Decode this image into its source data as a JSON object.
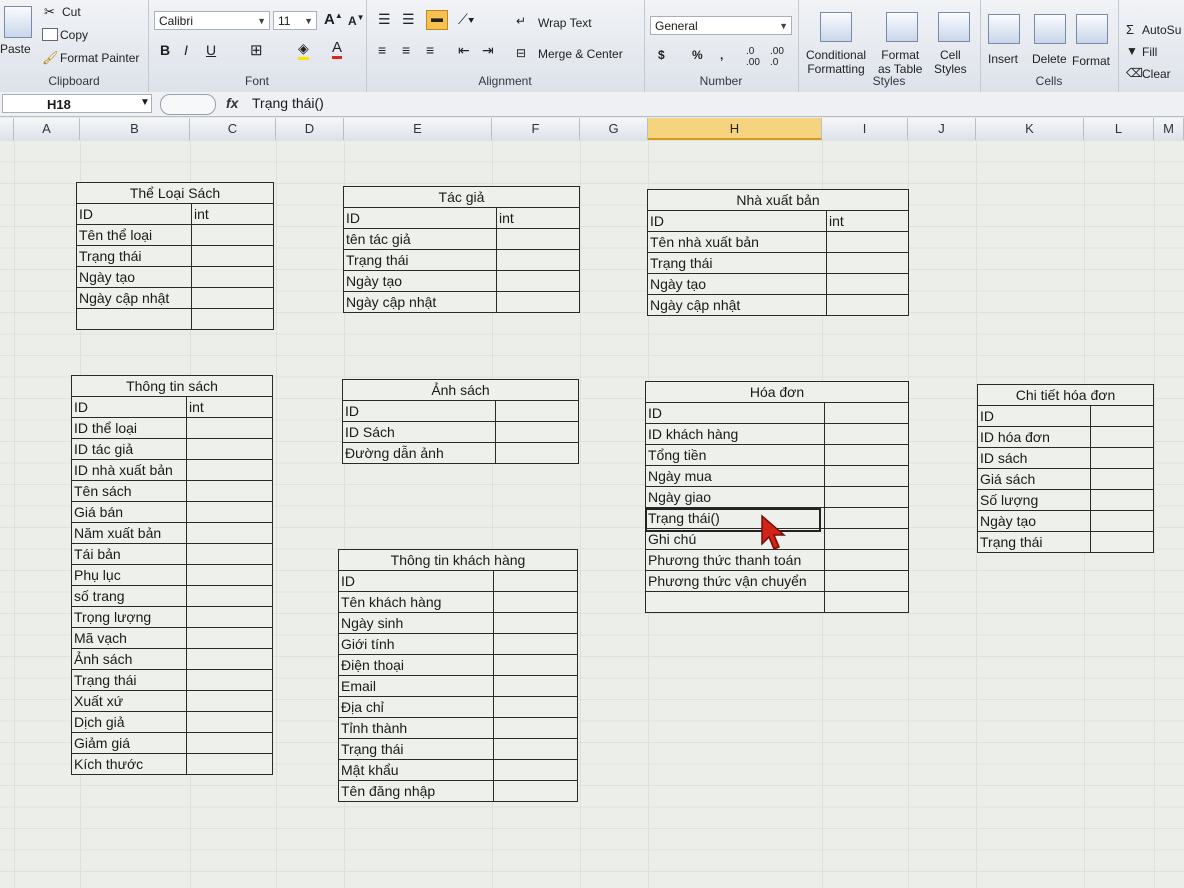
{
  "ribbon": {
    "clipboard": {
      "paste": "Paste",
      "cut": "Cut",
      "copy": "Copy",
      "format_painter": "Format Painter",
      "label": "Clipboard"
    },
    "font": {
      "name": "Calibri",
      "size": "11",
      "label": "Font"
    },
    "alignment": {
      "wrap": "Wrap Text",
      "merge": "Merge & Center",
      "label": "Alignment"
    },
    "number": {
      "format": "General",
      "currency": "$",
      "percent": "%",
      "comma": ",",
      "label": "Number"
    },
    "styles": {
      "conditional_1": "Conditional",
      "conditional_2": "Formatting",
      "format_table_1": "Format",
      "format_table_2": "as Table",
      "cell_styles_1": "Cell",
      "cell_styles_2": "Styles",
      "label": "Styles"
    },
    "cells": {
      "insert": "Insert",
      "delete": "Delete",
      "format": "Format",
      "label": "Cells"
    },
    "editing": {
      "autosum": "AutoSu",
      "fill": "Fill",
      "clear": "Clear"
    }
  },
  "formula_bar": {
    "name_box": "H18",
    "fx": "fx",
    "formula": "Trạng thái()"
  },
  "columns": [
    "A",
    "B",
    "C",
    "D",
    "E",
    "F",
    "G",
    "H",
    "I",
    "J",
    "K",
    "L",
    "M"
  ],
  "selected_column": "H",
  "tables": {
    "the_loai": {
      "title": "Thể Loại Sách",
      "rows": [
        [
          "ID",
          "int"
        ],
        [
          "Tên thể loại",
          ""
        ],
        [
          "Trạng thái",
          ""
        ],
        [
          "Ngày tạo",
          ""
        ],
        [
          "Ngày cập nhật",
          ""
        ],
        [
          "",
          ""
        ]
      ]
    },
    "tac_gia": {
      "title": "Tác giả",
      "rows": [
        [
          "ID",
          "int"
        ],
        [
          "tên tác giả",
          ""
        ],
        [
          "Trạng thái",
          ""
        ],
        [
          "Ngày tạo",
          ""
        ],
        [
          "Ngày cập nhật",
          ""
        ]
      ]
    },
    "nxb": {
      "title": "Nhà xuất bản",
      "rows": [
        [
          "ID",
          "int"
        ],
        [
          "Tên nhà xuất bản",
          ""
        ],
        [
          "Trạng thái",
          ""
        ],
        [
          "Ngày tạo",
          ""
        ],
        [
          "Ngày cập nhật",
          ""
        ]
      ]
    },
    "thong_tin_sach": {
      "title": "Thông tin sách",
      "rows": [
        [
          "ID",
          "int"
        ],
        [
          "ID thể loại",
          ""
        ],
        [
          "ID tác giả",
          ""
        ],
        [
          "ID nhà xuất bản",
          ""
        ],
        [
          "Tên sách",
          ""
        ],
        [
          "Giá bán",
          ""
        ],
        [
          "Năm xuất bản",
          ""
        ],
        [
          "Tái bản",
          ""
        ],
        [
          "Phụ lục",
          ""
        ],
        [
          "số trang",
          ""
        ],
        [
          "Trọng lượng",
          ""
        ],
        [
          "Mã vạch",
          ""
        ],
        [
          "Ảnh sách",
          ""
        ],
        [
          "Trạng thái",
          ""
        ],
        [
          "Xuất xứ",
          ""
        ],
        [
          "Dịch giả",
          ""
        ],
        [
          "Giảm giá",
          ""
        ],
        [
          "Kích thước",
          ""
        ]
      ]
    },
    "anh_sach": {
      "title": "Ảnh sách",
      "rows": [
        [
          "ID",
          ""
        ],
        [
          "ID Sách",
          ""
        ],
        [
          "Đường dẫn ảnh",
          ""
        ]
      ]
    },
    "khach_hang": {
      "title": "Thông tin khách hàng",
      "rows": [
        [
          "ID",
          ""
        ],
        [
          "Tên khách hàng",
          ""
        ],
        [
          "Ngày sinh",
          ""
        ],
        [
          "Giới tính",
          ""
        ],
        [
          "Điện thoại",
          ""
        ],
        [
          "Email",
          ""
        ],
        [
          "Địa chỉ",
          ""
        ],
        [
          "Tỉnh thành",
          ""
        ],
        [
          "Trạng thái",
          ""
        ],
        [
          "Mật khẩu",
          ""
        ],
        [
          "Tên đăng nhập",
          ""
        ]
      ]
    },
    "hoa_don": {
      "title": "Hóa đơn",
      "rows": [
        [
          "ID",
          ""
        ],
        [
          "ID khách hàng",
          ""
        ],
        [
          "Tổng tiền",
          ""
        ],
        [
          "Ngày mua",
          ""
        ],
        [
          "Ngày giao",
          ""
        ],
        [
          "Trạng thái()",
          ""
        ],
        [
          "Ghi chú",
          ""
        ],
        [
          "Phương thức thanh toán",
          ""
        ],
        [
          "Phương thức vận chuyển",
          ""
        ],
        [
          "",
          ""
        ]
      ]
    },
    "chi_tiet": {
      "title": "Chi tiết hóa đơn",
      "rows": [
        [
          "ID",
          ""
        ],
        [
          "ID hóa đơn",
          ""
        ],
        [
          "ID sách",
          ""
        ],
        [
          "Giá sách",
          ""
        ],
        [
          "Số lượng",
          ""
        ],
        [
          "Ngày tạo",
          ""
        ],
        [
          "Trạng thái",
          ""
        ]
      ]
    }
  }
}
